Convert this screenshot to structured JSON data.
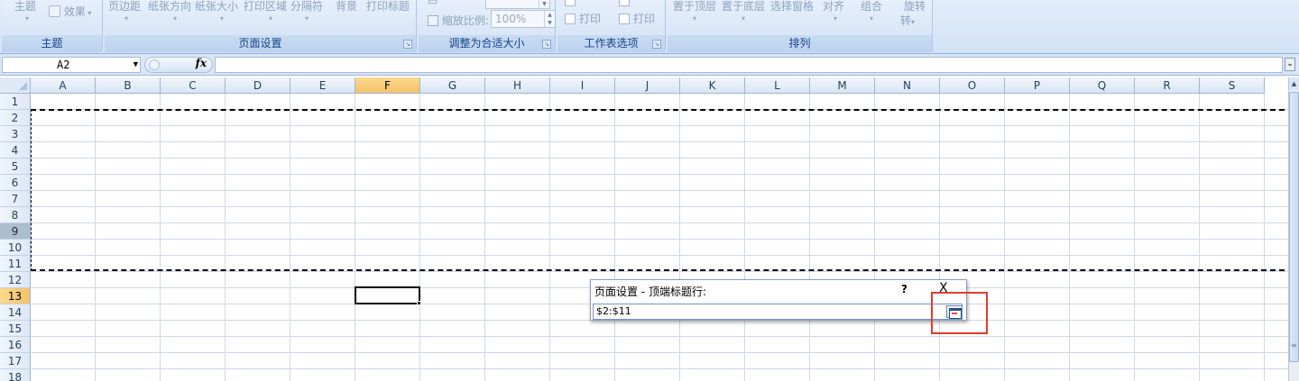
{
  "ribbon": {
    "themes": {
      "btn_theme": "主题",
      "btn_effects": "效果",
      "label": "主题"
    },
    "page_setup": {
      "buttons": [
        "页边距",
        "纸张方向",
        "纸张大小",
        "打印区域",
        "分隔符",
        "背景",
        "打印标题"
      ],
      "label": "页面设置"
    },
    "scale": {
      "scale_label": "缩放比例:",
      "scale_value": "100%",
      "label": "调整为合适大小"
    },
    "sheet_options": {
      "print1": "打印",
      "print2": "打印",
      "label": "工作表选项"
    },
    "arrange": {
      "buttons": [
        "置于顶层",
        "置于底层",
        "选择窗格",
        "对齐",
        "组合",
        "旋转"
      ],
      "rotate_bottom": "转",
      "label": "排列"
    }
  },
  "formula_bar": {
    "name_box": "A2",
    "fx": "fx",
    "formula": ""
  },
  "grid": {
    "columns": [
      "A",
      "B",
      "C",
      "D",
      "E",
      "F",
      "G",
      "H",
      "I",
      "J",
      "K",
      "L",
      "M",
      "N",
      "O",
      "P",
      "Q",
      "R",
      "S"
    ],
    "rows": [
      "1",
      "2",
      "3",
      "4",
      "5",
      "6",
      "7",
      "8",
      "9",
      "10",
      "11",
      "12",
      "13",
      "14",
      "15",
      "16",
      "17",
      "18"
    ],
    "selected_column": "F",
    "selected_row": "13",
    "band_rows": [
      "9"
    ]
  },
  "dialog": {
    "title": "页面设置 - 顶端标题行:",
    "help": "?",
    "close": "X",
    "value": "$2:$11"
  },
  "colors": {
    "ribbon_accent": "#15428b",
    "selected_header": "#f4c26a",
    "highlight_box": "#e03c31"
  }
}
